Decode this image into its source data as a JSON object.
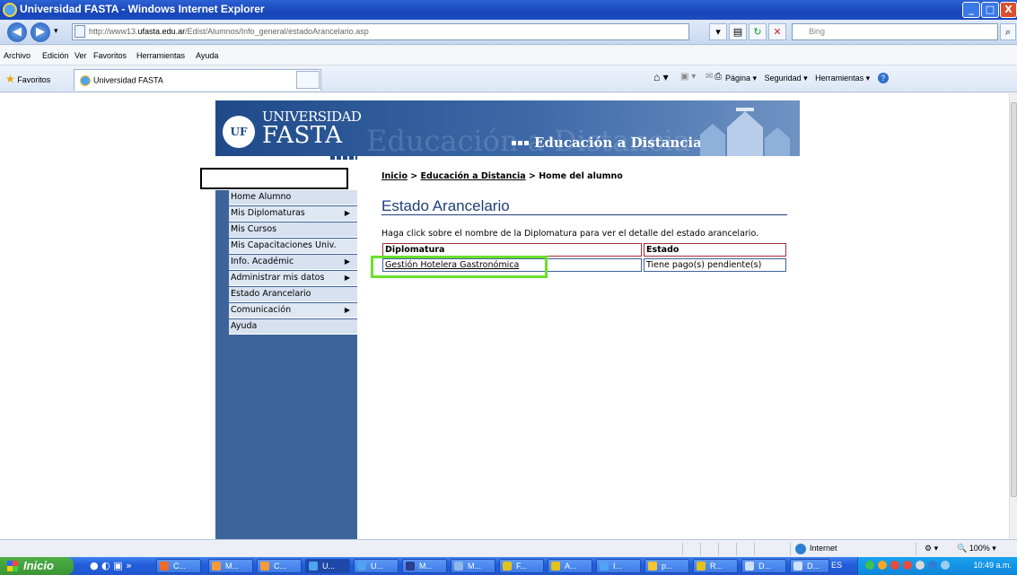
{
  "window": {
    "title": "Universidad FASTA - Windows Internet Explorer",
    "min_label": "_",
    "max_label": "□",
    "close_label": "X"
  },
  "address_bar": {
    "url_prefix": "http://www13.",
    "url_domain": "ufasta.edu.ar",
    "url_path": "/Edist/Alumnos/Info_general/estadoArancelario.asp",
    "search_placeholder": "Bing"
  },
  "menubar": {
    "items": [
      "Archivo",
      "Edición",
      "Ver",
      "Favoritos",
      "Herramientas",
      "Ayuda"
    ]
  },
  "favorites_bar": {
    "favorites_label": "Favoritos",
    "tab_title": "Universidad FASTA",
    "commands": [
      "Página ▾",
      "Seguridad ▾",
      "Herramientas ▾"
    ]
  },
  "header": {
    "logo_text": "UF",
    "university": "UNIVERSIDAD",
    "name": "FASTA",
    "subtitle": "Educación a Distancia",
    "watermark": "Educación a Distancia"
  },
  "sidebar": {
    "items": [
      {
        "label": "Home Alumno",
        "submenu": false
      },
      {
        "label": "Mis Diplomaturas",
        "submenu": true
      },
      {
        "label": "Mis Cursos",
        "submenu": false
      },
      {
        "label": "Mis Capacitaciones Univ.",
        "submenu": false
      },
      {
        "label": "Info. Académic",
        "submenu": true
      },
      {
        "label": "Administrar mis datos",
        "submenu": true
      },
      {
        "label": "Estado Arancelario",
        "submenu": false
      },
      {
        "label": "Comunicación",
        "submenu": true
      },
      {
        "label": "Ayuda",
        "submenu": false
      }
    ]
  },
  "breadcrumb": {
    "home": "Inicio",
    "section": "Educación a Distancia",
    "current": "Home del alumno",
    "sep": " > "
  },
  "content": {
    "title": "Estado Arancelario",
    "instruction": "Haga click sobre el nombre de la Diplomatura para ver el detalle del estado arancelario.",
    "table": {
      "headers": [
        "Diplomatura",
        "Estado"
      ],
      "rows": [
        {
          "diplomatura": "Gestión Hotelera Gastronómica",
          "estado": "Tiene pago(s) pendiente(s)"
        }
      ]
    }
  },
  "statusbar": {
    "zone": "Internet",
    "zoom": "100%"
  },
  "taskbar": {
    "start_label": "Inicio",
    "buttons": [
      "C...",
      "M...",
      "C...",
      "U...",
      "U...",
      "M...",
      "M...",
      "F...",
      "A...",
      "I...",
      "p...",
      "R...",
      "D...",
      "D..."
    ],
    "lang": "ES",
    "clock": "10:49 a.m."
  },
  "colors": {
    "header_blue": "#1f4a8a",
    "sidebar_blue": "#3d6499",
    "title_blue": "#1f3e78",
    "highlight_green": "#6be12a",
    "table_header_border": "#a0303a"
  }
}
